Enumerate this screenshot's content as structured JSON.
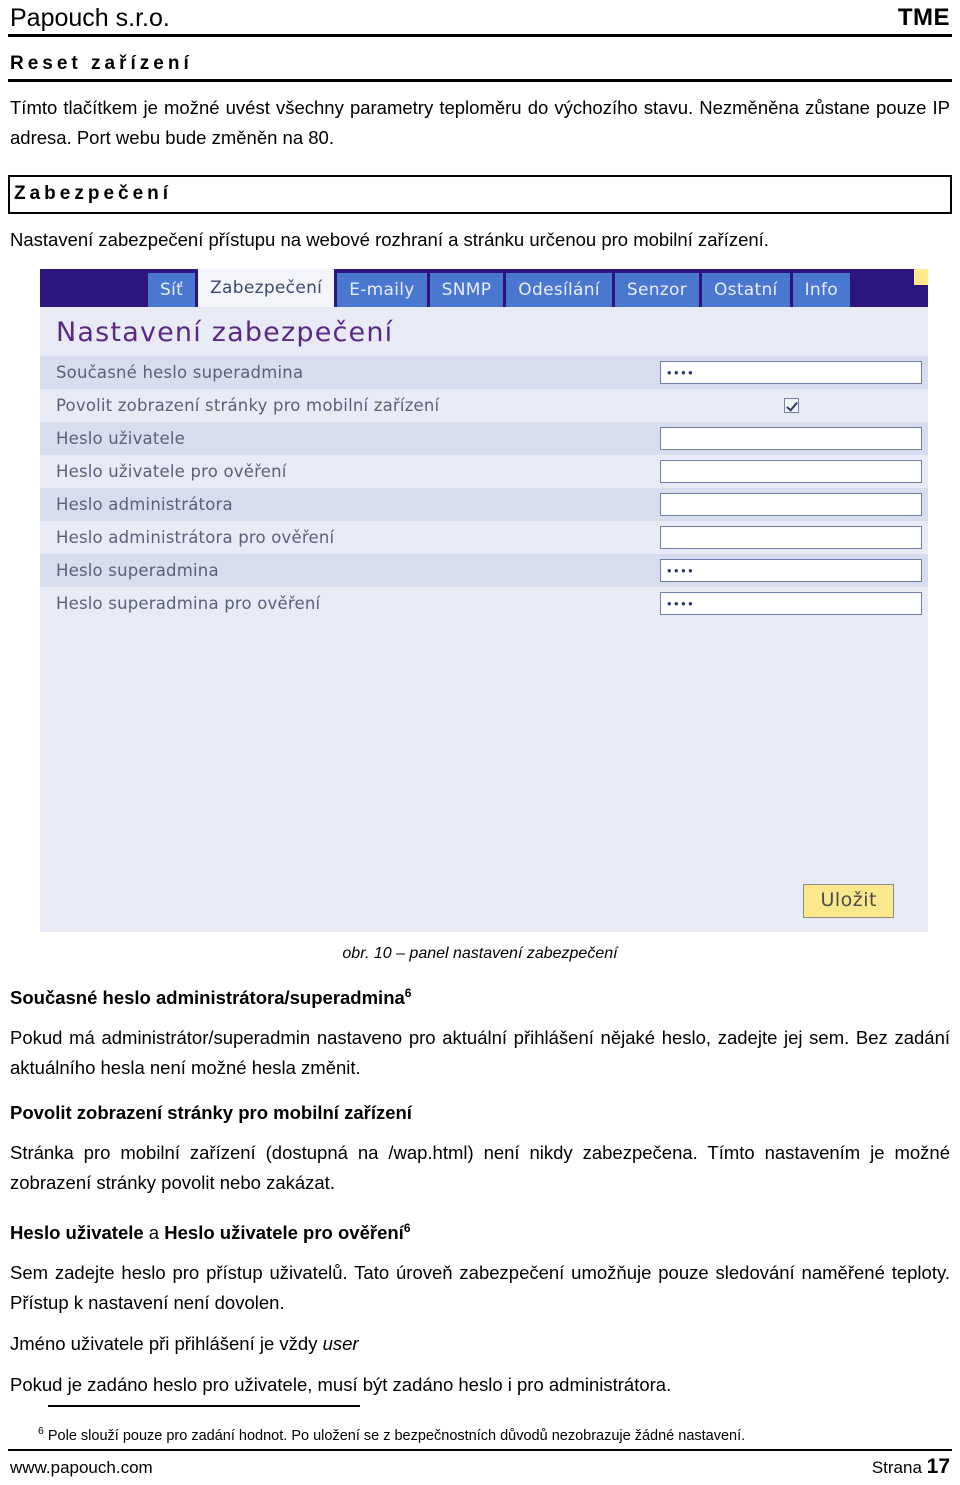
{
  "header": {
    "brand": "Papouch s.r.o.",
    "product": "TME"
  },
  "sections": {
    "reset": {
      "heading": "Reset zařízení",
      "paragraph": "Tímto tlačítkem je možné uvést všechny parametry teploměru do výchozího stavu. Nezměněna zůstane pouze IP adresa. Port webu bude změněn na 80."
    },
    "security": {
      "heading": "Zabezpečení",
      "paragraph": "Nastavení zabezpečení přístupu na webové rozhraní a stránku určenou pro mobilní zařízení."
    }
  },
  "screenshot": {
    "tabs": [
      {
        "label": "Síť",
        "active": false
      },
      {
        "label": "Zabezpečení",
        "active": true
      },
      {
        "label": "E-maily",
        "active": false
      },
      {
        "label": "SNMP",
        "active": false
      },
      {
        "label": "Odesílání",
        "active": false
      },
      {
        "label": "Senzor",
        "active": false
      },
      {
        "label": "Ostatní",
        "active": false
      },
      {
        "label": "Info",
        "active": false
      }
    ],
    "panel_title": "Nastavení zabezpečení",
    "rows": [
      {
        "label": "Současné heslo superadmina",
        "type": "password",
        "value": "••••"
      },
      {
        "label": "Povolit zobrazení stránky pro mobilní zařízení",
        "type": "checkbox",
        "checked": true
      },
      {
        "label": "Heslo uživatele",
        "type": "password",
        "value": ""
      },
      {
        "label": "Heslo uživatele pro ověření",
        "type": "password",
        "value": ""
      },
      {
        "label": "Heslo administrátora",
        "type": "password",
        "value": ""
      },
      {
        "label": "Heslo administrátora pro ověření",
        "type": "password",
        "value": ""
      },
      {
        "label": "Heslo superadmina",
        "type": "password",
        "value": "••••"
      },
      {
        "label": "Heslo superadmina pro ověření",
        "type": "password",
        "value": "••••"
      }
    ],
    "save_label": "Uložit",
    "colors": {
      "tabbar_bg": "#2d157e",
      "tab_bg": "#4a77cf",
      "tab_active_bg": "#f4f5fb",
      "panel_bg": "#e8ebf5",
      "row_alt_bg": "#d8ddee",
      "title_color": "#5a2a82",
      "save_bg": "#fbe88c",
      "corner_accent": "#ffe98a"
    }
  },
  "figure": {
    "caption": "obr. 10 – panel nastavení zabezpečení"
  },
  "explanations": [
    {
      "title": "Současné heslo administrátora/superadmina",
      "footnote_marker": "6",
      "body": "Pokud má administrátor/superadmin nastaveno pro aktuální přihlášení nějaké heslo, zadejte jej sem. Bez zadání aktuálního hesla není možné hesla změnit."
    },
    {
      "title": "Povolit zobrazení stránky pro mobilní zařízení",
      "footnote_marker": "",
      "body": "Stránka pro mobilní zařízení (dostupná na /wap.html) není nikdy zabezpečena. Tímto nastavením je možné zobrazení stránky povolit nebo zakázat."
    }
  ],
  "user_password_block": {
    "title_part1": "Heslo uživatele",
    "title_conj": " a ",
    "title_part2": "Heslo uživatele pro ověření",
    "footnote_marker": "6",
    "body": "Sem zadejte heslo pro přístup uživatelů. Tato úroveň zabezpečení umožňuje pouze sledování naměřené teploty. Přístup k nastavení není dovolen.",
    "note_prefix": "Jméno uživatele při přihlášení je vždy ",
    "note_italic": "user",
    "closing": "Pokud je zadáno heslo pro uživatele, musí být zadáno heslo i pro administrátora."
  },
  "footnote": {
    "marker": "6",
    "text": "Pole slouží pouze pro zadání hodnot. Po uložení se z bezpečnostních důvodů nezobrazuje žádné nastavení."
  },
  "footer": {
    "website": "www.papouch.com",
    "page_word": "Strana",
    "page_number": "17"
  }
}
